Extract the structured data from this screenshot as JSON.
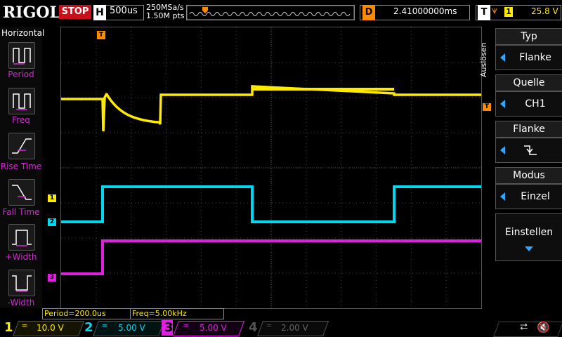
{
  "topbar": {
    "brand": "RIGOL",
    "run_state": "STOP",
    "horizontal_key": "H",
    "timebase": "500us",
    "sample_rate": "250MSa/s",
    "memory_depth": "1.50M pts",
    "delay_key": "D",
    "delay_value": "2.41000000ms",
    "trigger_key": "T",
    "trigger_channel": "1",
    "trigger_level": "25.8 V"
  },
  "left_panel": {
    "title": "Horizontal",
    "items": [
      {
        "label": "Period",
        "icon": "period-icon"
      },
      {
        "label": "Freq",
        "icon": "freq-icon"
      },
      {
        "label": "Rise Time",
        "icon": "rise-time-icon"
      },
      {
        "label": "Fall Time",
        "icon": "fall-time-icon"
      },
      {
        "label": "+Width",
        "icon": "positive-width-icon"
      },
      {
        "label": "-Width",
        "icon": "negative-width-icon"
      }
    ]
  },
  "right_panel": {
    "menu_title": "Auslösen",
    "items": [
      {
        "header": "Typ",
        "value": "Flanke"
      },
      {
        "header": "Quelle",
        "value": "CH1"
      },
      {
        "header": "Flanke",
        "value": "falling-edge-icon"
      },
      {
        "header": "Modus",
        "value": "Einzel"
      }
    ],
    "settings_label": "Einstellen"
  },
  "measurements": {
    "period": "Period=200.0us",
    "freq": "Freq=5.00kHz"
  },
  "channels": [
    {
      "number": "1",
      "scale": "10.0 V",
      "color": "#ffeb00",
      "active": true
    },
    {
      "number": "2",
      "scale": "5.00 V",
      "color": "#00d8f0",
      "active": true
    },
    {
      "number": "3",
      "scale": "5.00 V",
      "color": "#e020e0",
      "active": true
    },
    {
      "number": "4",
      "scale": "2.00 V",
      "color": "#555555",
      "active": false
    }
  ],
  "markers": {
    "ch1": "1",
    "ch2": "2",
    "ch3": "3",
    "trigger": "T"
  },
  "colors": {
    "stop": "#c8101a",
    "trigger_marker": "#ff8c00",
    "menu_arrow": "#2ea6ff"
  }
}
